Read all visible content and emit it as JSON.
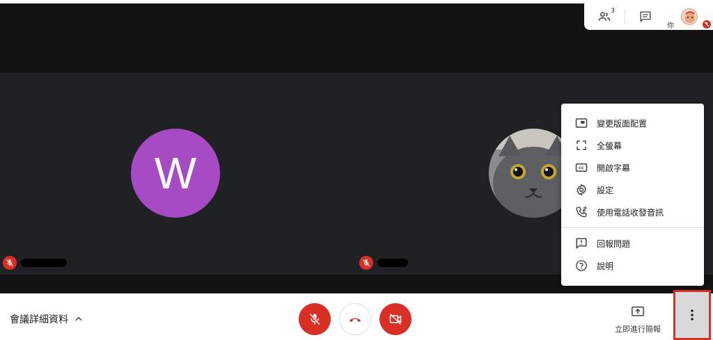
{
  "participants_panel": {
    "people_count": "3",
    "self_label": "你"
  },
  "tiles": [
    {
      "avatar_letter": "W",
      "avatar_color": "#a64bc4"
    },
    {
      "avatar_type": "photo"
    }
  ],
  "menu": {
    "items": [
      {
        "label": "變更版面配置",
        "icon": "layout-icon"
      },
      {
        "label": "全螢幕",
        "icon": "fullscreen-icon"
      },
      {
        "label": "開啟字幕",
        "icon": "captions-icon"
      },
      {
        "label": "設定",
        "icon": "settings-icon"
      },
      {
        "label": "使用電話收發音訊",
        "icon": "phone-audio-icon"
      }
    ],
    "secondary_items": [
      {
        "label": "回報問題",
        "icon": "report-icon"
      },
      {
        "label": "說明",
        "icon": "help-icon"
      }
    ]
  },
  "bottom_bar": {
    "meeting_details_label": "會議詳細資料",
    "present_label": "立即進行簡報"
  },
  "colors": {
    "danger": "#d93025",
    "stage_bg": "#202124",
    "avatar_purple": "#a64bc4"
  }
}
